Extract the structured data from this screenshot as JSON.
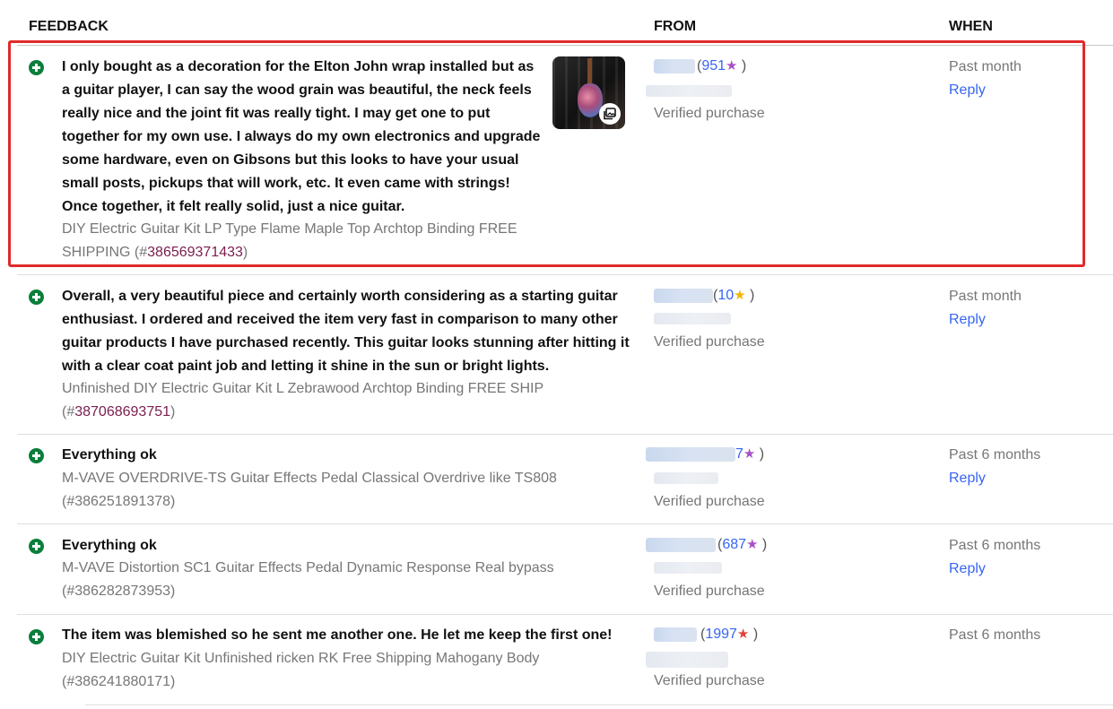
{
  "headers": {
    "feedback": "FEEDBACK",
    "from": "FROM",
    "when": "WHEN"
  },
  "rows": [
    {
      "comment_lines": [
        "I only bought as a decoration for the Elton John wrap installed but as",
        "a guitar player, I can say the wood grain was beautiful, the neck feels",
        "really nice and the joint fit was really tight. I may get one to put",
        "together for my own use. I always do my own electronics and upgrade",
        "some hardware, even on Gibsons but this looks to have your usual",
        "small posts, pickups that will work, etc. It even came with strings!",
        "Once together, it felt really solid, just a nice guitar."
      ],
      "item_line1": "DIY Electric Guitar Kit LP Type Flame Maple Top Archtop Binding FREE",
      "item_pre": "SHIPPING (#",
      "item_number": "386569371433",
      "item_post": ")",
      "score": "951",
      "verified": "Verified purchase",
      "when": "Past month",
      "reply": "Reply"
    },
    {
      "comment_lines": [
        "Overall, a very beautiful piece and certainly worth considering as a starting guitar",
        "enthusiast. I ordered and received the item very fast in comparison to many other",
        "guitar products I have purchased recently. This guitar looks stunning after hitting it",
        "with a clear coat paint job and letting it shine in the sun or bright lights."
      ],
      "item_line1": "Unfinished DIY Electric Guitar Kit L Zebrawood Archtop Binding FREE SHIP",
      "item_pre": "(#",
      "item_number": "387068693751",
      "item_post": ")",
      "score": "10",
      "verified": "Verified purchase",
      "when": "Past month",
      "reply": "Reply"
    },
    {
      "comment_lines": [
        "Everything ok"
      ],
      "item_line1": "M-VAVE OVERDRIVE-TS Guitar Effects Pedal Classical Overdrive like TS808",
      "item_line2": "(#386251891378)",
      "score": "7",
      "verified": "Verified purchase",
      "when": "Past 6 months",
      "reply": "Reply"
    },
    {
      "comment_lines": [
        "Everything ok"
      ],
      "item_line1": "M-VAVE Distortion SC1 Guitar Effects Pedal Dynamic Response Real bypass",
      "item_line2": "(#386282873953)",
      "score": "687",
      "verified": "Verified purchase",
      "when": "Past 6 months",
      "reply": "Reply"
    },
    {
      "comment_lines": [
        "The item was blemished so he sent me another one. He let me keep the first one!"
      ],
      "item_line1": "DIY Electric Guitar Kit Unfinished ricken RK Free Shipping Mahogany Body",
      "item_line2": "(#386241880171)",
      "score": "1997",
      "verified": "Verified purchase",
      "when": "Past 6 months"
    }
  ],
  "icons": {
    "positive": "plus-circle-icon",
    "photo": "photo-gallery-icon",
    "star": "star-icon"
  },
  "colors": {
    "highlight": "#e02a2a",
    "positive": "#0a7e3b",
    "link": "#3665f3",
    "item_link": "#7a1d4e"
  }
}
